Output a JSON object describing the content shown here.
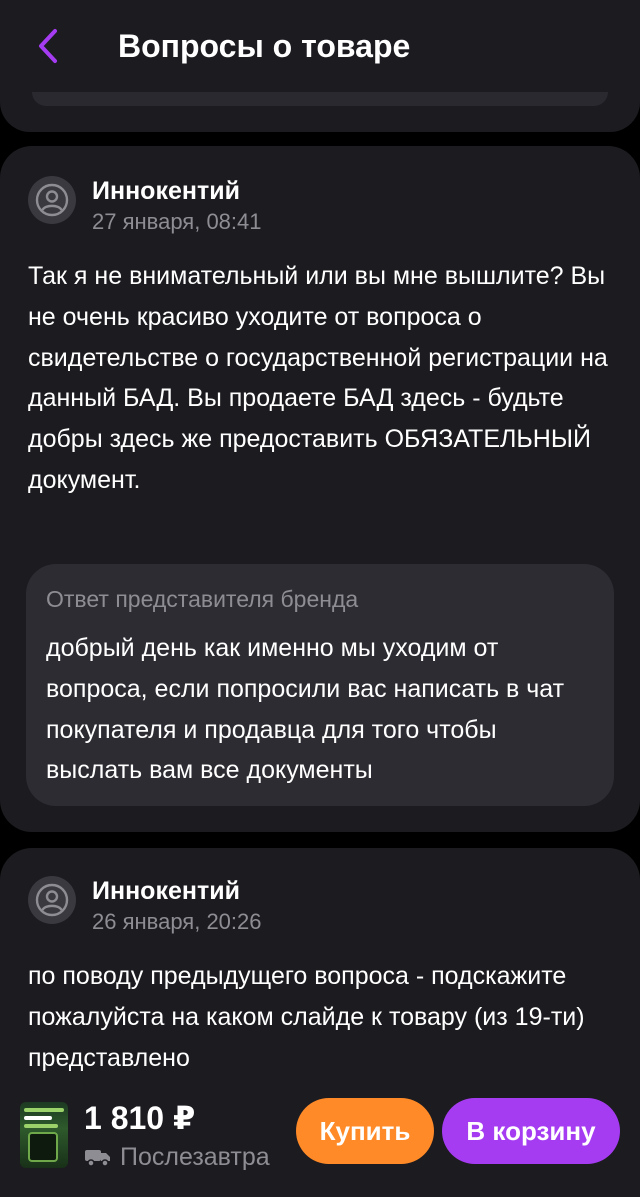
{
  "header": {
    "title": "Вопросы о товаре",
    "back_icon": "chevron-left-icon",
    "accent_color": "#a53cf2"
  },
  "questions": [
    {
      "author": "Иннокентий",
      "date": "27 января, 08:41",
      "text": "Так я не внимательный или вы мне вышлите? Вы не очень красиво уходите от вопроса о свидетельстве о государственной регистрации на данный БАД. Вы продаете БАД здесь - будьте добры здесь же предоставить ОБЯЗАТЕЛЬНЫЙ документ.",
      "answer": {
        "label": "Ответ представителя бренда",
        "text": "добрый день как именно мы уходим от вопроса, если попросили вас написать в чат покупателя и продавца для того чтобы выслать вам все документы"
      }
    },
    {
      "author": "Иннокентий",
      "date": "26 января, 20:26",
      "text": "по поводу предыдущего вопроса - подскажите пожалуйста на каком слайде к товару (из 19-ти) представлено"
    }
  ],
  "bottom_bar": {
    "price": "1 810 ₽",
    "delivery": "Послезавтра",
    "delivery_icon": "truck-icon",
    "buy_label": "Купить",
    "cart_label": "В корзину",
    "buy_color": "#ff8a27",
    "cart_color": "#a53cf2"
  }
}
